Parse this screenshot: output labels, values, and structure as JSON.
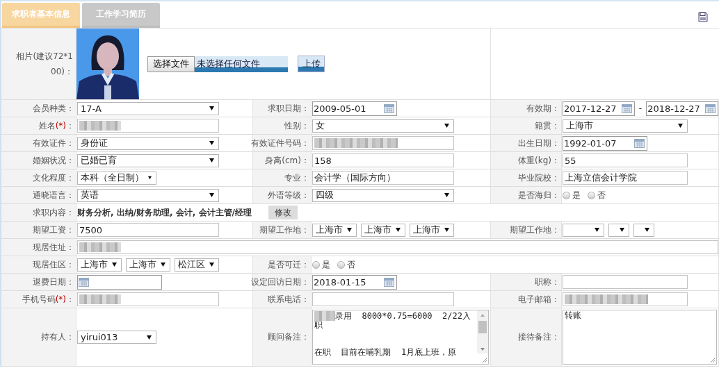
{
  "tabs": [
    {
      "label": "求职者基本信息",
      "selected": true
    },
    {
      "label": "工作学习简历",
      "selected": false
    }
  ],
  "photo": {
    "label": "相片(建议72*100)：",
    "choose_button": "选择文件",
    "file_status": "未选择任何文件",
    "upload_button": "上传"
  },
  "rows": [
    {
      "cells": [
        {
          "label": "会员种类：",
          "kind": "select",
          "value": "17-A"
        },
        {
          "label": "求职日期：",
          "kind": "date",
          "value": "2009-05-01"
        },
        {
          "label": "有效期：",
          "kind": "daterange",
          "from": "2017-12-27",
          "separator": "-",
          "to": "2018-12-27"
        }
      ]
    },
    {
      "cells": [
        {
          "label": "姓名",
          "required": "(*)",
          "colon": "：",
          "kind": "text",
          "redacted": true
        },
        {
          "label": "性别：",
          "kind": "select",
          "value": "女"
        },
        {
          "label": "籍贯：",
          "kind": "select",
          "value": "上海市"
        }
      ]
    },
    {
      "cells": [
        {
          "label": "有效证件：",
          "kind": "select",
          "value": "身份证"
        },
        {
          "label": "有效证件号码：",
          "kind": "text",
          "redacted": true
        },
        {
          "label": "出生日期：",
          "kind": "date",
          "value": "1992-01-07"
        }
      ]
    },
    {
      "cells": [
        {
          "label": "婚姻状况：",
          "kind": "select",
          "value": "已婚已育"
        },
        {
          "label": "身高(cm)：",
          "kind": "text",
          "value": "158"
        },
        {
          "label": "体重(kg)：",
          "kind": "text",
          "value": "55"
        }
      ]
    },
    {
      "cells": [
        {
          "label": "文化程度：",
          "kind": "select",
          "value": "本科（全日制）"
        },
        {
          "label": "专业：",
          "kind": "text",
          "value": "会计学（国际方向）"
        },
        {
          "label": "毕业院校：",
          "kind": "text",
          "value": "上海立信会计学院"
        }
      ]
    },
    {
      "cells": [
        {
          "label": "通晓语言：",
          "kind": "select",
          "value": "英语"
        },
        {
          "label": "外语等级：",
          "kind": "select",
          "value": "四级"
        },
        {
          "label": "是否海归：",
          "kind": "radio",
          "options": [
            {
              "label": "是",
              "selected": false
            },
            {
              "label": "否",
              "selected": false
            }
          ]
        }
      ]
    },
    {
      "cells": [
        {
          "label": "求职内容：",
          "kind": "static",
          "value": "财务分析, 出纳/财务助理, 会计, 会计主管/经理",
          "button": "修改"
        }
      ]
    },
    {
      "cells": [
        {
          "label": "期望工资：",
          "kind": "text",
          "value": "7500"
        },
        {
          "label": "期望工作地：",
          "kind": "selects",
          "selects": [
            {
              "value": "上海市"
            },
            {
              "value": "上海市"
            },
            {
              "value": "上海市"
            }
          ]
        },
        {
          "label": "期望工作地：",
          "kind": "selects",
          "selects": [
            {
              "kind": "empty"
            },
            {
              "kind": "empty"
            },
            {
              "kind": "empty"
            }
          ]
        }
      ]
    },
    {
      "cells": [
        {
          "label": "现居住址：",
          "kind": "text",
          "redacted": true
        }
      ]
    },
    {
      "cells": [
        {
          "label": "现居住区：",
          "kind": "selects",
          "selects": [
            {
              "value": "上海市"
            },
            {
              "value": "上海市"
            },
            {
              "value": "松江区"
            }
          ]
        },
        {
          "label": "是否可迁：",
          "kind": "radio",
          "options": [
            {
              "label": "是",
              "selected": false
            },
            {
              "label": "否",
              "selected": false
            }
          ]
        }
      ]
    },
    {
      "cells": [
        {
          "label": "退费日期：",
          "kind": "date"
        },
        {
          "label": "设定回访日期：",
          "kind": "date",
          "value": "2018-01-15"
        },
        {
          "label": "职称：",
          "kind": "text"
        }
      ]
    },
    {
      "cells": [
        {
          "label": "手机号码",
          "required": "(*)",
          "colon": "：",
          "kind": "text",
          "redacted": true
        },
        {
          "label": "联系电话：",
          "kind": "text"
        },
        {
          "label": "电子邮箱：",
          "kind": "text",
          "redacted": true
        }
      ]
    },
    {
      "cells": [
        {
          "label": "持有人：",
          "kind": "select",
          "value": "yirui013"
        },
        {
          "label": "顾问备注：",
          "kind": "textarea",
          "scrollbar": true,
          "lines": [
            {
              "redacted": true,
              "text": "录用  8000*0.75=6000  2/22入"
            },
            {
              "text": "职"
            },
            {
              "text": "在职  目前在哺乳期  1月底上班，原",
              "gap": true
            }
          ]
        },
        {
          "label": "接待备注：",
          "kind": "textarea",
          "lines": [
            {
              "text": "转账"
            }
          ]
        }
      ]
    }
  ]
}
